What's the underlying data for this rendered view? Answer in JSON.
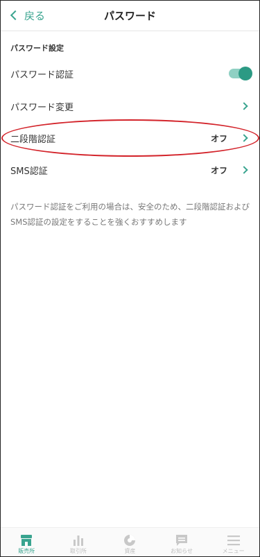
{
  "header": {
    "back_label": "戻る",
    "title": "パスワード"
  },
  "section": {
    "title": "パスワード設定"
  },
  "rows": [
    {
      "label": "パスワード認証",
      "type": "toggle",
      "value": "on"
    },
    {
      "label": "パスワード変更",
      "type": "link"
    },
    {
      "label": "二段階認証",
      "type": "link",
      "value": "オフ"
    },
    {
      "label": "SMS認証",
      "type": "link",
      "value": "オフ"
    }
  ],
  "note": "パスワード認証をご利用の場合は、安全のため、二段階認証およびSMS認証の設定をすることを強くおすすめします",
  "tabbar": {
    "tabs": [
      {
        "label": "販売所",
        "icon": "shop-icon",
        "active": true
      },
      {
        "label": "取引所",
        "icon": "bar-chart-icon"
      },
      {
        "label": "資産",
        "icon": "pie-chart-icon"
      },
      {
        "label": "お知らせ",
        "icon": "message-icon"
      },
      {
        "label": "メニュー",
        "icon": "menu-icon"
      }
    ]
  },
  "colors": {
    "accent": "#39a48f",
    "highlight": "#d3232a"
  }
}
